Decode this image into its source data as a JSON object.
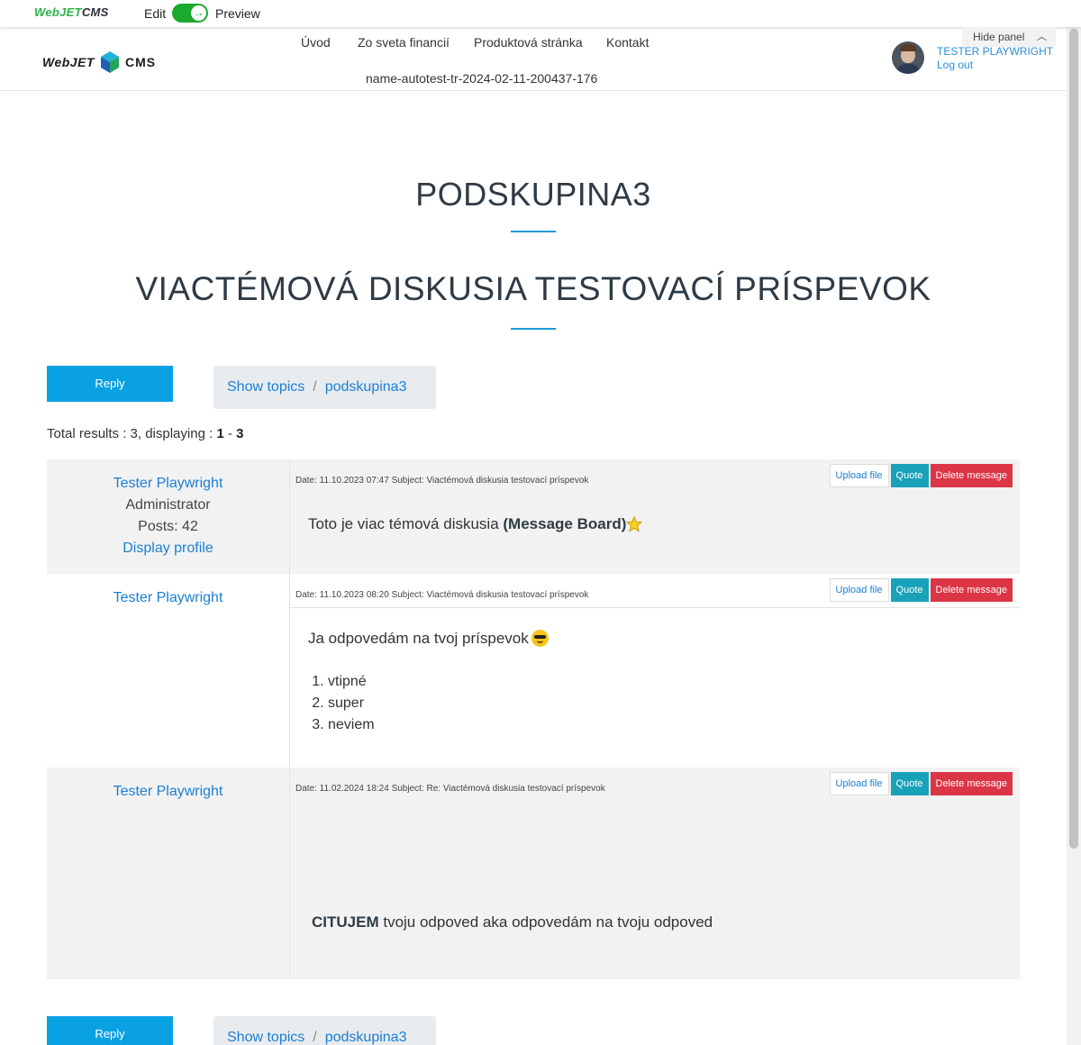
{
  "adminbar": {
    "brand_green": "WebJET",
    "brand_dark": "CMS",
    "edit_label": "Edit",
    "preview_label": "Preview"
  },
  "header": {
    "logo_left": "WebJET",
    "logo_right": "CMS",
    "nav": [
      "Úvod",
      "Zo sveta financií",
      "Produktová stránka",
      "Kontakt",
      "name-autotest-tr-2024-02-11-200437-176"
    ],
    "user_name": "TESTER PLAYWRIGHT",
    "logout": "Log out",
    "hide_panel": "Hide panel"
  },
  "page": {
    "title": "PODSKUPINA3",
    "subtitle": "VIACTÉMOVÁ DISKUSIA TESTOVACÍ PRÍSPEVOK",
    "reply": "Reply",
    "breadcrumb_root": "Show topics",
    "breadcrumb_sep": "/",
    "breadcrumb_current": "podskupina3",
    "total_prefix": "Total results : 3, displaying : ",
    "total_from": "1",
    "total_dash": " - ",
    "total_to": "3"
  },
  "actions": {
    "upload": "Upload file",
    "quote": "Quote",
    "delete": "Delete message"
  },
  "messages": [
    {
      "author": "Tester Playwright",
      "role": "Administrator",
      "posts": "Posts: 42",
      "profile": "Display profile",
      "meta": "Date: 11.10.2023 07:47 Subject: Viactémová diskusia testovací príspevok",
      "text": "Toto je viac témová diskusia ",
      "bold": "(Message Board)"
    },
    {
      "author": "Tester Playwright",
      "meta": "Date: 11.10.2023 08:20 Subject: Viactémová diskusia testovací príspevok",
      "text": "Ja odpovedám na tvoj príspevok",
      "items": [
        "vtipné",
        "super",
        "neviem"
      ]
    },
    {
      "author": "Tester Playwright",
      "meta": "Date: 11.02.2024 18:24 Subject: Re: Viactémová diskusia testovací príspevok",
      "bold": "CITUJEM",
      "text": " tvoju odpoved aka odpovedám na tvoju odpoved"
    }
  ],
  "colors": {
    "accent": "#0aa1e2",
    "link": "#1a7fd2",
    "quote": "#17a2b8",
    "delete": "#dc3545",
    "toggle": "#1aaa2e"
  }
}
